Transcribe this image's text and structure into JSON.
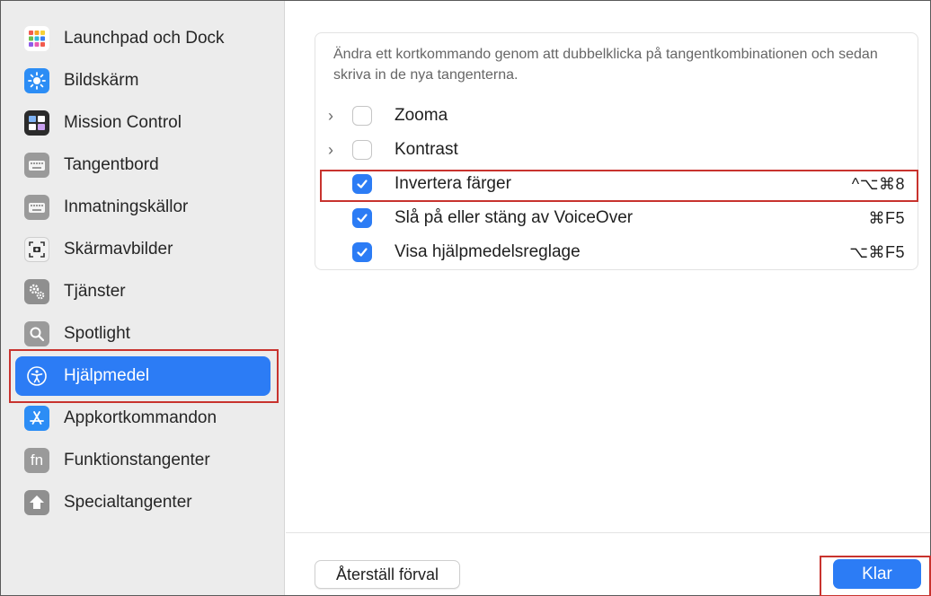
{
  "sidebar": {
    "items": [
      {
        "label": "Launchpad och Dock",
        "icon": "launchpad-icon"
      },
      {
        "label": "Bildskärm",
        "icon": "display-icon"
      },
      {
        "label": "Mission Control",
        "icon": "mission-control-icon"
      },
      {
        "label": "Tangentbord",
        "icon": "keyboard-icon"
      },
      {
        "label": "Inmatningskällor",
        "icon": "input-sources-icon"
      },
      {
        "label": "Skärmavbilder",
        "icon": "screenshot-icon"
      },
      {
        "label": "Tjänster",
        "icon": "services-icon"
      },
      {
        "label": "Spotlight",
        "icon": "spotlight-icon"
      },
      {
        "label": "Hjälpmedel",
        "icon": "accessibility-icon",
        "selected": true
      },
      {
        "label": "Appkortkommandon",
        "icon": "app-shortcuts-icon"
      },
      {
        "label": "Funktionstangenter",
        "icon": "function-keys-icon"
      },
      {
        "label": "Specialtangenter",
        "icon": "modifier-keys-icon"
      }
    ]
  },
  "main": {
    "description": "Ändra ett kortkommando genom att dubbelklicka på tangentkombinationen och sedan skriva in de nya tangenterna.",
    "rows": [
      {
        "label": "Zooma",
        "checked": false,
        "expandable": true,
        "shortcut": ""
      },
      {
        "label": "Kontrast",
        "checked": false,
        "expandable": true,
        "shortcut": ""
      },
      {
        "label": "Invertera färger",
        "checked": true,
        "expandable": false,
        "shortcut": "^⌥⌘8"
      },
      {
        "label": "Slå på eller stäng av VoiceOver",
        "checked": true,
        "expandable": false,
        "shortcut": "⌘F5"
      },
      {
        "label": "Visa hjälpmedelsreglage",
        "checked": true,
        "expandable": false,
        "shortcut": "⌥⌘F5"
      }
    ],
    "reset_label": "Återställ förval",
    "done_label": "Klar"
  },
  "colors": {
    "accent": "#2c7cf5",
    "highlight_outline": "#c8332e",
    "sidebar_bg": "#ececec"
  }
}
